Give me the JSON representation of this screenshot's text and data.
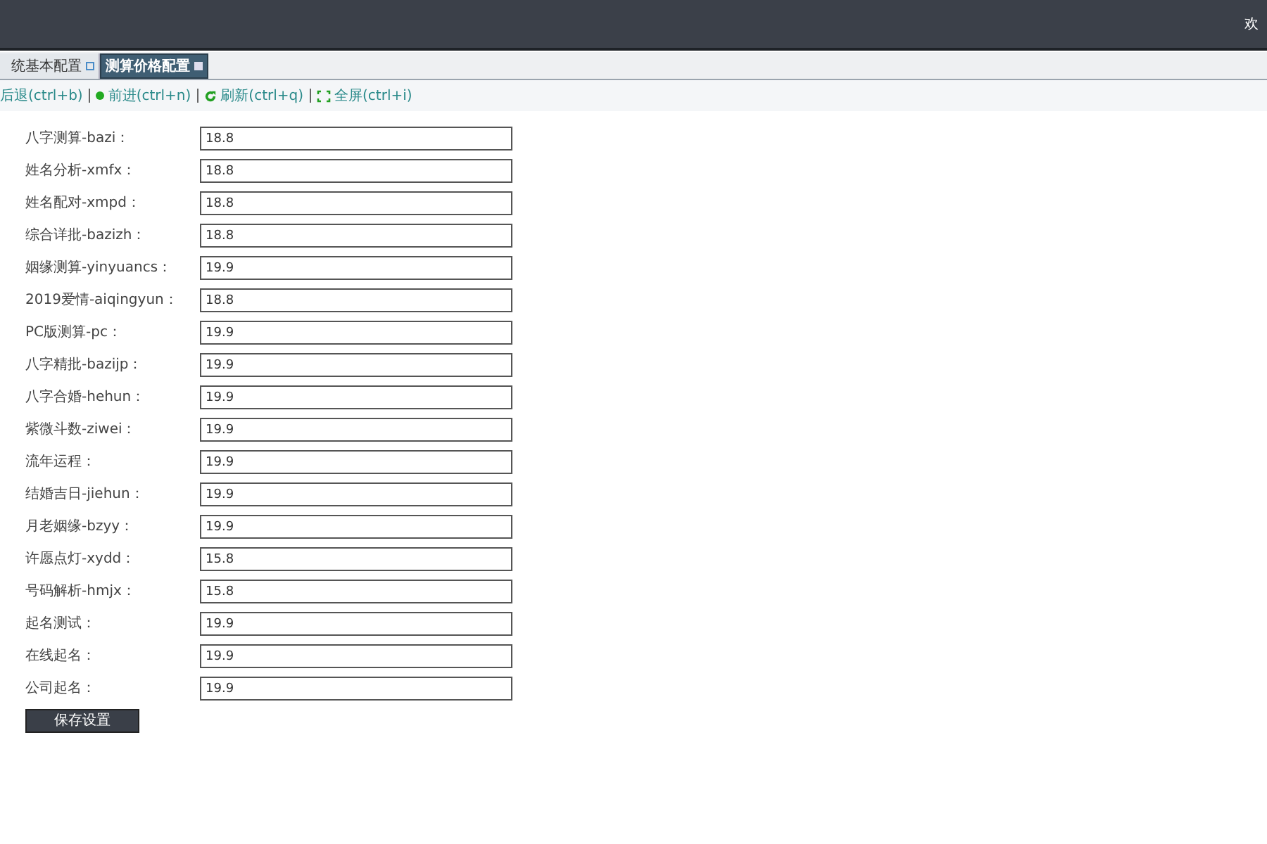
{
  "header": {
    "welcome": "欢"
  },
  "tabs": [
    {
      "label": "统基本配置",
      "selected": false
    },
    {
      "label": "测算价格配置",
      "selected": true
    }
  ],
  "toolbar": [
    {
      "kind": "back",
      "label": "后退(ctrl+b)"
    },
    {
      "kind": "forward",
      "label": "前进(ctrl+n)"
    },
    {
      "kind": "refresh",
      "label": "刷新(ctrl+q)"
    },
    {
      "kind": "fullscreen",
      "label": "全屏(ctrl+i)"
    }
  ],
  "fields": [
    {
      "label": "八字测算-bazi：",
      "value": "18.8"
    },
    {
      "label": "姓名分析-xmfx：",
      "value": "18.8"
    },
    {
      "label": "姓名配对-xmpd：",
      "value": "18.8"
    },
    {
      "label": "综合详批-bazizh：",
      "value": "18.8"
    },
    {
      "label": "姻缘测算-yinyuancs：",
      "value": "19.9"
    },
    {
      "label": "2019爱情-aiqingyun：",
      "value": "18.8"
    },
    {
      "label": "PC版测算-pc：",
      "value": "19.9"
    },
    {
      "label": "八字精批-bazijp：",
      "value": "19.9"
    },
    {
      "label": "八字合婚-hehun：",
      "value": "19.9"
    },
    {
      "label": "紫微斗数-ziwei：",
      "value": "19.9"
    },
    {
      "label": "流年运程：",
      "value": "19.9"
    },
    {
      "label": "结婚吉日-jiehun：",
      "value": "19.9"
    },
    {
      "label": "月老姻缘-bzyy：",
      "value": "19.9"
    },
    {
      "label": "许愿点灯-xydd：",
      "value": "15.8"
    },
    {
      "label": "号码解析-hmjx：",
      "value": "15.8"
    },
    {
      "label": "起名测试：",
      "value": "19.9"
    },
    {
      "label": "在线起名：",
      "value": "19.9"
    },
    {
      "label": "公司起名：",
      "value": "19.9"
    }
  ],
  "save_button": "保存设置"
}
